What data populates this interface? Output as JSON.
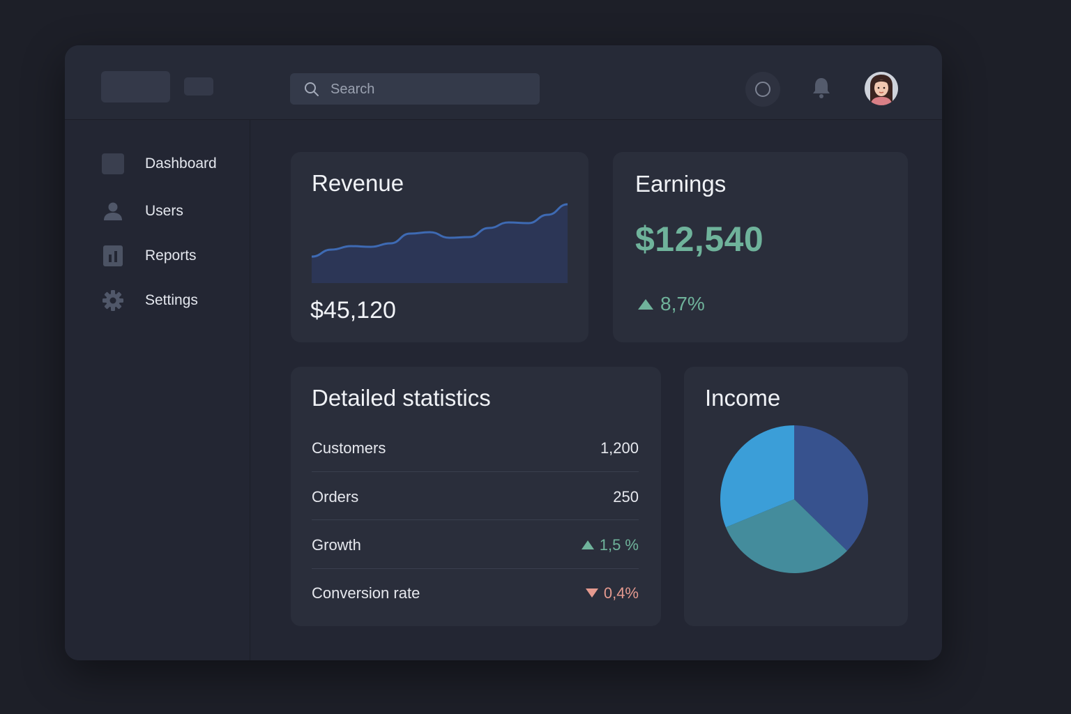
{
  "search": {
    "placeholder": "Search"
  },
  "sidebar": {
    "items": [
      {
        "label": "Dashboard",
        "icon": "dashboard-square-icon"
      },
      {
        "label": "Users",
        "icon": "user-icon"
      },
      {
        "label": "Reports",
        "icon": "bar-chart-icon"
      },
      {
        "label": "Settings",
        "icon": "gear-icon"
      }
    ]
  },
  "header": {
    "icons": [
      "circle-icon",
      "bell-icon",
      "avatar"
    ]
  },
  "revenue": {
    "title": "Revenue",
    "value": "$45,120",
    "chart_data": {
      "type": "area",
      "title": "Revenue",
      "values": [
        38,
        48,
        53,
        52,
        57,
        71,
        73,
        65,
        66,
        79,
        87,
        86,
        98,
        113
      ],
      "ylim": [
        0,
        120
      ],
      "grid": false,
      "line_color": "#3e6ab3",
      "fill_color": "#2c3656"
    }
  },
  "earnings": {
    "title": "Earnings",
    "value": "$12,540",
    "change": "8,7%"
  },
  "stats": {
    "title": "Detailed statistics",
    "rows": [
      {
        "label": "Customers",
        "value": "1,200"
      },
      {
        "label": "Orders",
        "value": "250"
      },
      {
        "label": "Growth",
        "value": "1,5 %",
        "trend": "up"
      },
      {
        "label": "Conversion rate",
        "value": "0,4%",
        "trend": "down"
      }
    ]
  },
  "income": {
    "title": "Income",
    "chart_data": {
      "type": "pie",
      "title": "Income",
      "values": [
        37.3,
        31.5,
        31.2
      ],
      "colors": [
        "#37528e",
        "#448c9c",
        "#3b9ed8"
      ]
    }
  },
  "colors": {
    "accent_green": "#6fb39b",
    "accent_red": "#e59a8f",
    "background": "#1d1f28"
  }
}
